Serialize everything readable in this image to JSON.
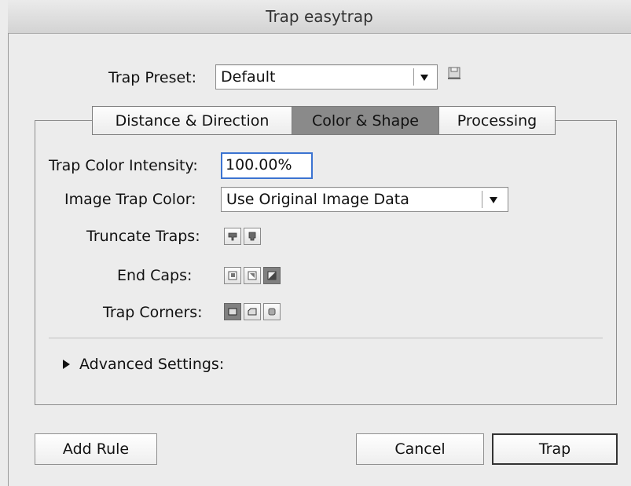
{
  "window": {
    "title": "Trap easytrap"
  },
  "preset": {
    "label": "Trap Preset:",
    "value": "Default",
    "icon": "save-preset-icon"
  },
  "tabs": [
    {
      "label": "Distance & Direction",
      "active": false
    },
    {
      "label": "Color & Shape",
      "active": true
    },
    {
      "label": "Processing",
      "active": false
    }
  ],
  "color_shape": {
    "intensity_label": "Trap Color Intensity:",
    "intensity_value": "100.00%",
    "image_color_label": "Image Trap Color:",
    "image_color_value": "Use Original Image Data",
    "truncate_label": "Truncate Traps:",
    "truncate_options": [
      {
        "icon": "truncate-trap-icon",
        "selected": false
      },
      {
        "icon": "no-truncate-trap-icon",
        "selected": false
      }
    ],
    "endcaps_label": "End Caps:",
    "endcaps_options": [
      {
        "icon": "end-cap-icon-1",
        "selected": false
      },
      {
        "icon": "end-cap-icon-2",
        "selected": false
      },
      {
        "icon": "end-cap-icon-3",
        "selected": true
      }
    ],
    "corners_label": "Trap Corners:",
    "corners_options": [
      {
        "icon": "mitered-corner-icon",
        "selected": true
      },
      {
        "icon": "beveled-corner-icon",
        "selected": false
      },
      {
        "icon": "rounded-corner-icon",
        "selected": false
      }
    ],
    "advanced_label": "Advanced Settings:"
  },
  "buttons": {
    "add_rule": "Add Rule",
    "cancel": "Cancel",
    "trap": "Trap"
  },
  "colors": {
    "focus_ring": "#3b73d1",
    "selected_button": "#808080",
    "active_tab": "#8a8a8a"
  }
}
